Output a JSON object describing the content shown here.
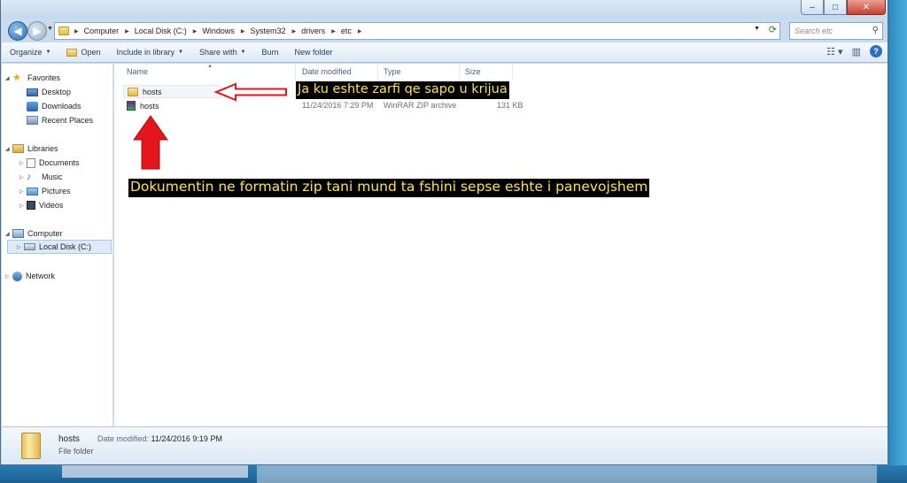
{
  "window": {
    "controls": {
      "minimize": "–",
      "maximize": "□",
      "close": "✕"
    }
  },
  "address": {
    "crumbs": [
      "Computer",
      "Local Disk (C:)",
      "Windows",
      "System32",
      "drivers",
      "etc"
    ],
    "search_placeholder": "Search etc"
  },
  "toolbar": {
    "organize": "Organize",
    "open": "Open",
    "include": "Include in library",
    "share": "Share with",
    "burn": "Burn",
    "new_folder": "New folder"
  },
  "sidebar": {
    "favorites": "Favorites",
    "desktop": "Desktop",
    "downloads": "Downloads",
    "recent": "Recent Places",
    "libraries": "Libraries",
    "documents": "Documents",
    "music": "Music",
    "pictures": "Pictures",
    "videos": "Videos",
    "computer": "Computer",
    "local_disk": "Local Disk (C:)",
    "network": "Network"
  },
  "columns": {
    "name": "Name",
    "date": "Date modified",
    "type": "Type",
    "size": "Size"
  },
  "files": [
    {
      "name": "hosts",
      "date": "",
      "type": "",
      "size": ""
    },
    {
      "name": "hosts",
      "date": "11/24/2016 7:29 PM",
      "type": "WinRAR ZIP archive",
      "size": "131 KB"
    }
  ],
  "annotations": {
    "callout1": "Ja ku eshte zarfi qe sapo u krijua",
    "callout2": "Dokumentin ne formatin zip tani mund ta fshini sepse eshte i panevojshem",
    "color_arrow": "#e4161b",
    "color_text": "#ffe24a"
  },
  "details": {
    "name": "hosts",
    "type": "File folder",
    "modified_label": "Date modified:",
    "modified_value": "11/24/2016 9:19 PM"
  }
}
